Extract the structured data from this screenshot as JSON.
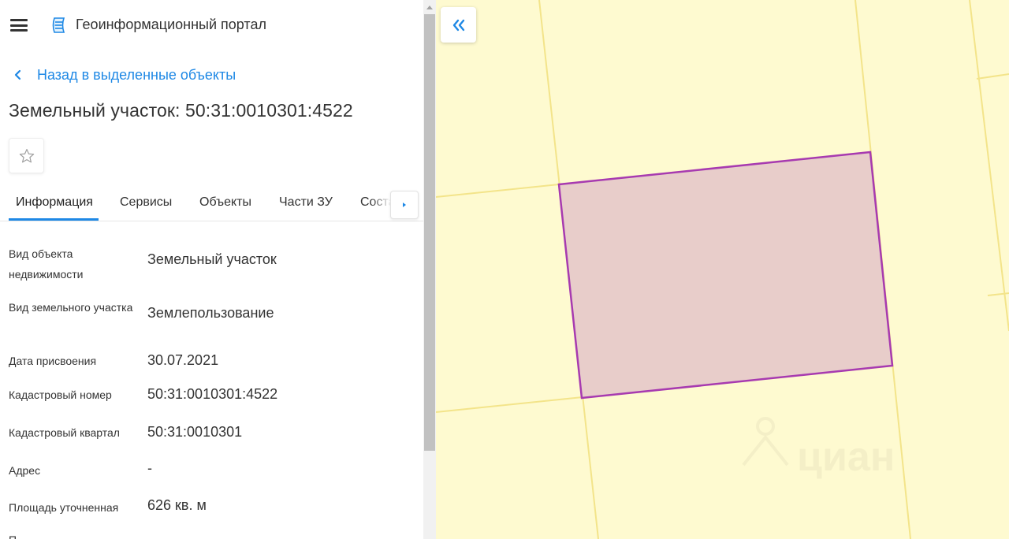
{
  "header": {
    "app_title": "Геоинформационный портал",
    "menu_icon": "hamburger-menu-icon",
    "logo_icon": "portal-logo-icon"
  },
  "back_link": {
    "label": "Назад в выделенные объекты",
    "icon": "chevron-left-icon"
  },
  "object": {
    "title": "Земельный участок: 50:31:0010301:4522",
    "favorite_icon": "star-outline-icon"
  },
  "tabs": [
    {
      "label": "Информация",
      "active": true
    },
    {
      "label": "Сервисы",
      "active": false
    },
    {
      "label": "Объекты",
      "active": false
    },
    {
      "label": "Части ЗУ",
      "active": false
    },
    {
      "label": "Состав ЗУ",
      "active": false
    }
  ],
  "properties": [
    {
      "label": "Вид объекта недвижимости",
      "value": "Земельный участок"
    },
    {
      "label": "Вид земельного участка",
      "value": "Землепользование"
    },
    {
      "label": "Дата присвоения",
      "value": "30.07.2021"
    },
    {
      "label": "Кадастровый номер",
      "value": "50:31:0010301:4522"
    },
    {
      "label": "Кадастровый квартал",
      "value": "50:31:0010301"
    },
    {
      "label": "Адрес",
      "value": "-"
    },
    {
      "label": "Площадь уточненная",
      "value": "626 кв. м"
    },
    {
      "label": "П",
      "value": ""
    }
  ],
  "map": {
    "collapse_icon": "double-chevron-left-icon",
    "watermark": "циан",
    "colors": {
      "background": "#fefad0",
      "parcel_border": "#f3e48a",
      "selected_fill": "#e8cdca",
      "selected_stroke": "#a73ab0"
    }
  },
  "colors": {
    "accent": "#1e88e5",
    "text": "#333333"
  }
}
